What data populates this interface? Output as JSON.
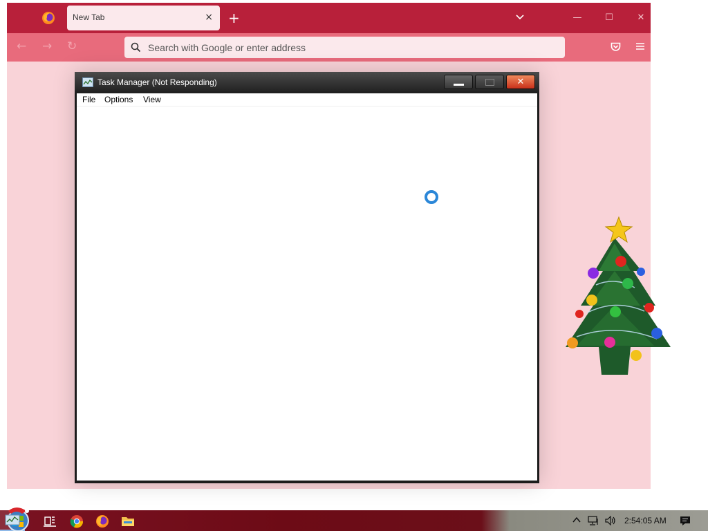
{
  "browser": {
    "tab_title": "New Tab",
    "tab_close_glyph": "×",
    "new_tab_glyph": "+",
    "window_minimize_glyph": "—",
    "window_maximize_glyph": "☐",
    "window_close_glyph": "✕",
    "back_glyph": "←",
    "forward_glyph": "→",
    "reload_glyph": "↻",
    "address_placeholder": "Search with Google or enter address",
    "colors": {
      "tabbar": "#b8203a",
      "navbar": "#e86b7c",
      "content": "#f9d3d8"
    },
    "icons": [
      "firefox-icon",
      "chevron-down-icon",
      "search-icon",
      "pocket-icon",
      "hamburger-menu-icon"
    ]
  },
  "task_manager": {
    "title": "Task Manager (Not Responding)",
    "menu": [
      "File",
      "Options",
      "View"
    ],
    "close_glyph": "✕",
    "loading": true
  },
  "taskbar": {
    "pinned": [
      "task-view-icon",
      "chrome-icon",
      "firefox-icon",
      "file-explorer-icon",
      "task-manager-icon"
    ],
    "active_app": "Task Manager",
    "clock": "2:54:05 AM"
  }
}
